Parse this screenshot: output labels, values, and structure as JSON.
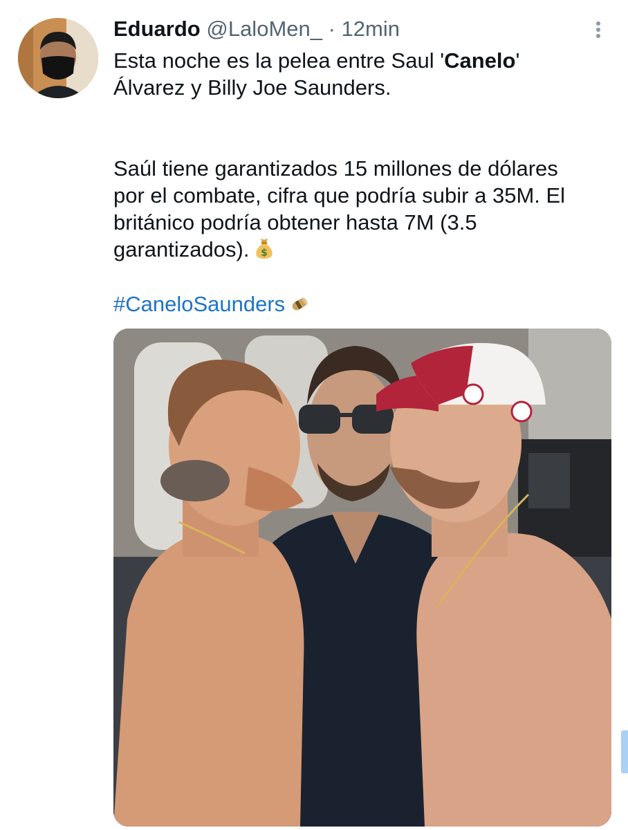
{
  "tweet": {
    "author_name": "Eduardo",
    "handle": "@LaloMen_",
    "separator": "·",
    "time": "12min",
    "text_line1_prefix": "Esta noche es la pelea entre Saul '",
    "text_line1_bold": "Canelo",
    "text_line1_suffix": "'",
    "text_line2": "Álvarez y Billy Joe Saunders.",
    "text_para2_line1": "Saúl tiene garantizados 15 millones de dólares",
    "text_para2_line2": "por el combate, cifra que podría subir a 35M. El",
    "text_para2_line3": "británico podría obtener hasta 7M (3.5",
    "text_para2_line4": "garantizados).",
    "hashtag": "#CaneloSaunders",
    "emoji_after_text": "money-bag-icon",
    "emoji_after_hashtag": "money-roll-icon"
  },
  "colors": {
    "hashtag": "#1d74c5",
    "secondary_text": "#536471",
    "primary_text": "#0f1419"
  }
}
